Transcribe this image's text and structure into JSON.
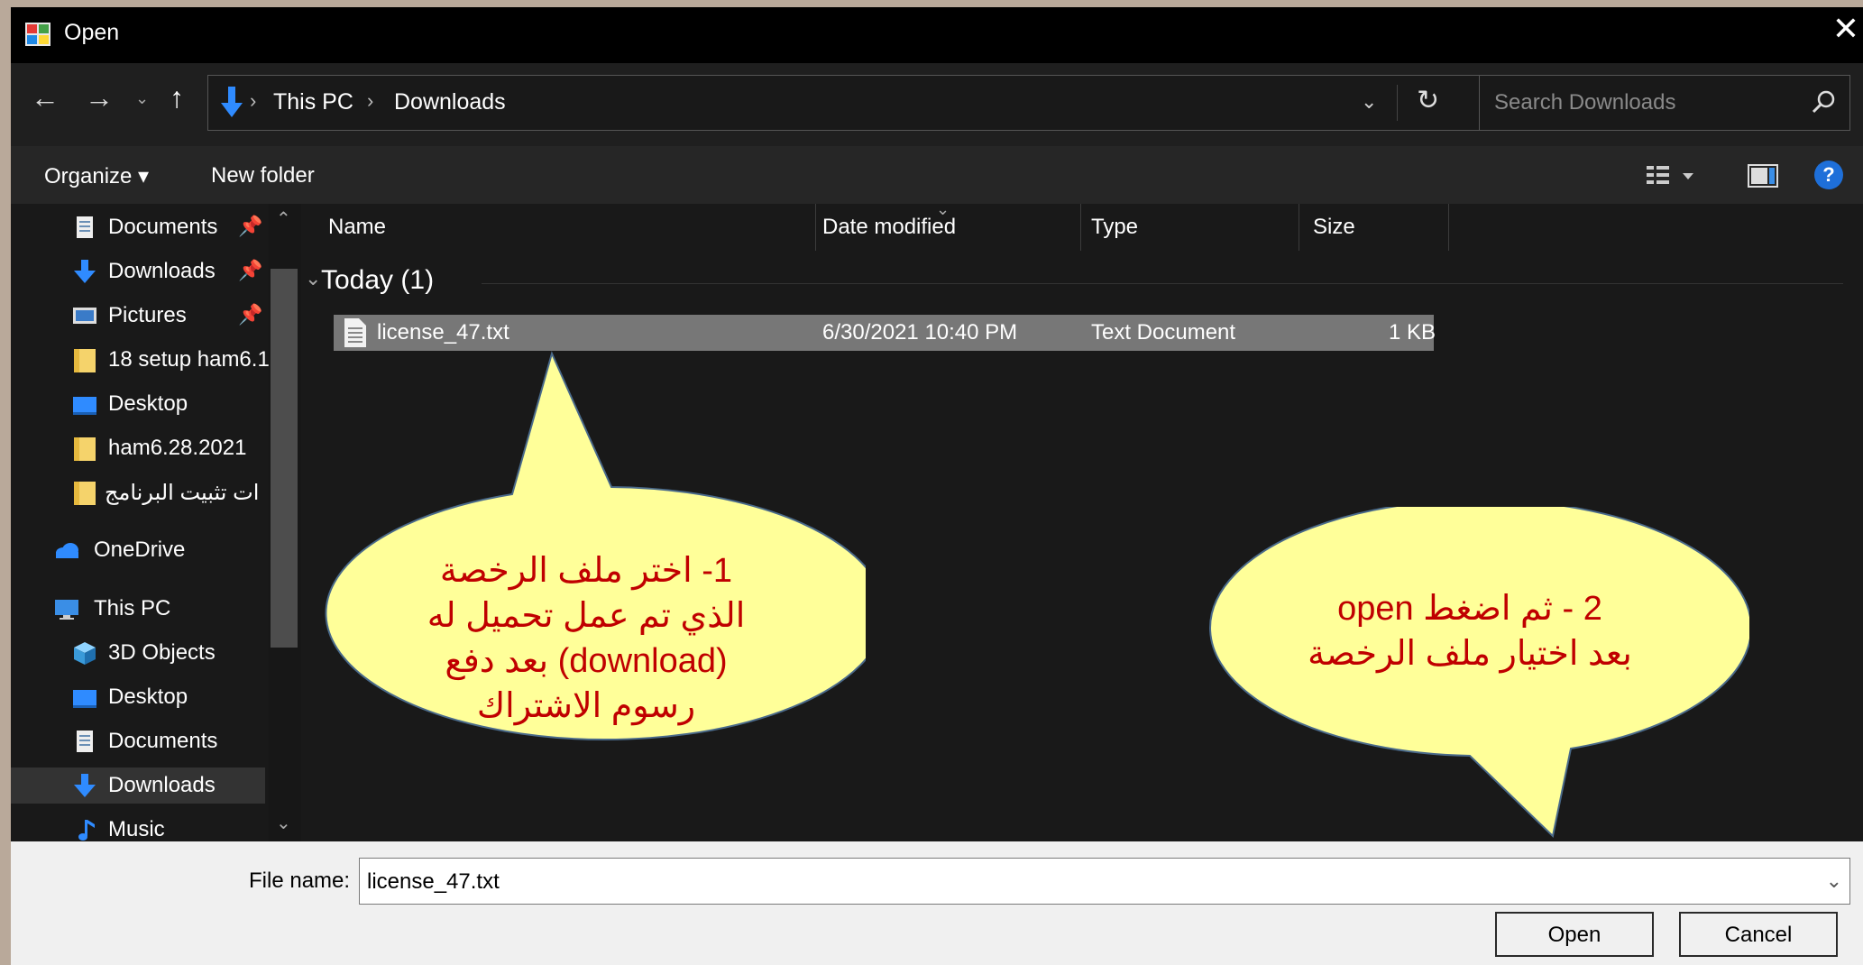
{
  "window": {
    "title": "Open"
  },
  "address": {
    "crumbs": [
      "This PC",
      "Downloads"
    ],
    "search_placeholder": "Search Downloads"
  },
  "toolbar": {
    "organize": "Organize ▾",
    "new_folder": "New folder"
  },
  "nav_pane": {
    "items": [
      {
        "label": "Documents",
        "icon": "document-icon",
        "pinned": true
      },
      {
        "label": "Downloads",
        "icon": "download-arrow-icon",
        "pinned": true
      },
      {
        "label": "Pictures",
        "icon": "pictures-icon",
        "pinned": true
      },
      {
        "label": "18 setup ham6.1",
        "icon": "folder-icon"
      },
      {
        "label": "Desktop",
        "icon": "desktop-icon"
      },
      {
        "label": "ham6.28.2021",
        "icon": "folder-icon"
      },
      {
        "label": "ات تثبيت البرنامج",
        "icon": "folder-icon"
      },
      {
        "label": "OneDrive",
        "icon": "cloud-icon"
      },
      {
        "label": "This PC",
        "icon": "computer-icon"
      },
      {
        "label": "3D Objects",
        "icon": "cube-icon"
      },
      {
        "label": "Desktop",
        "icon": "desktop-icon"
      },
      {
        "label": "Documents",
        "icon": "document-icon"
      },
      {
        "label": "Downloads",
        "icon": "download-arrow-icon",
        "selected": true
      },
      {
        "label": "Music",
        "icon": "music-note-icon"
      }
    ]
  },
  "file_list": {
    "columns": [
      "Name",
      "Date modified",
      "Type",
      "Size"
    ],
    "group": "Today (1)",
    "rows": [
      {
        "name": "license_47.txt",
        "date": "6/30/2021 10:40 PM",
        "type": "Text Document",
        "size": "1 KB"
      }
    ]
  },
  "callouts": {
    "first": [
      "1-  اختر ملف الرخصة",
      "الذي تم عمل تحميل له",
      "(download) بعد دفع",
      "رسوم الاشتراك"
    ],
    "second": [
      "2 -  ثم اضغط open",
      "بعد اختيار ملف الرخصة"
    ]
  },
  "bottom": {
    "file_name_label": "File name:",
    "file_name_value": "license_47.txt",
    "open_button": "Open",
    "cancel_button": "Cancel"
  },
  "colors": {
    "callout_fill": "#ffff99",
    "callout_text": "#c00000",
    "accent": "#1e6fd9"
  }
}
